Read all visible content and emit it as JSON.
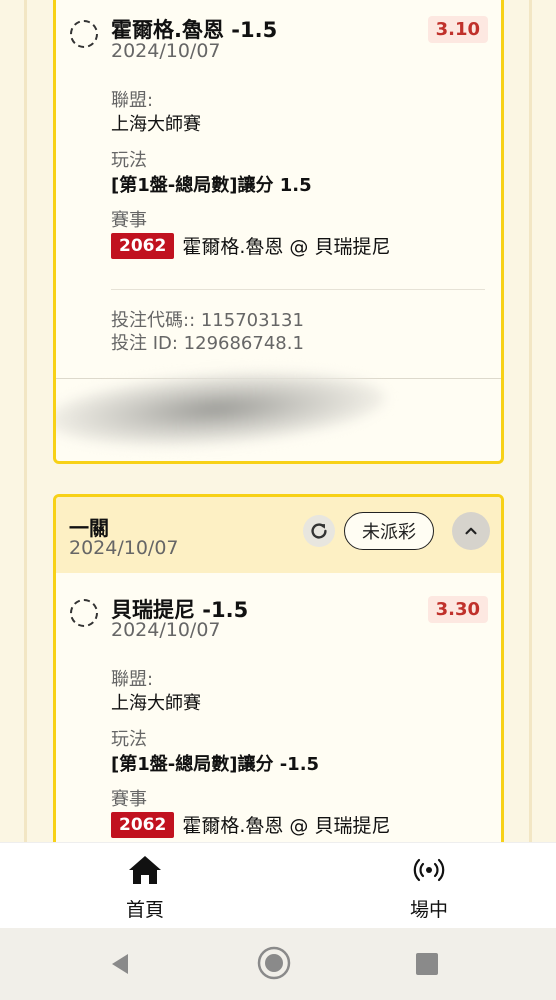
{
  "cards": [
    {
      "selection": {
        "title": "霍爾格.魯恩 -1.5",
        "date": "2024/10/07",
        "odds": "3.10",
        "league_label": "聯盟:",
        "league": "上海大師賽",
        "play_label": "玩法",
        "play": "[第1盤-總局數]讓分 1.5",
        "event_label": "賽事",
        "match_id": "2062",
        "match_name": "霍爾格.魯恩 @ 貝瑞提尼",
        "bet_code": "投注代碼:: 115703131",
        "bet_id": "投注 ID: 129686748.1"
      }
    },
    {
      "header": {
        "title": "一關",
        "date": "2024/10/07",
        "status": "未派彩"
      },
      "selection": {
        "title": "貝瑞提尼 -1.5",
        "date": "2024/10/07",
        "odds": "3.30",
        "league_label": "聯盟:",
        "league": "上海大師賽",
        "play_label": "玩法",
        "play": "[第1盤-總局數]讓分 -1.5",
        "event_label": "賽事",
        "match_id": "2062",
        "match_name": "霍爾格.魯恩 @ 貝瑞提尼"
      }
    }
  ],
  "bottom_nav": {
    "items": [
      {
        "label": "首頁",
        "icon": "home-icon"
      },
      {
        "label": "場中",
        "icon": "live-broadcast-icon"
      }
    ]
  },
  "system_nav": {
    "icons": [
      "back-icon",
      "home-circle-icon",
      "recents-icon"
    ]
  },
  "colors": {
    "card_border": "#f7d117",
    "odds_text": "#c0312b",
    "match_badge": "#c1121f",
    "header_bg": "#fdf0c4"
  }
}
